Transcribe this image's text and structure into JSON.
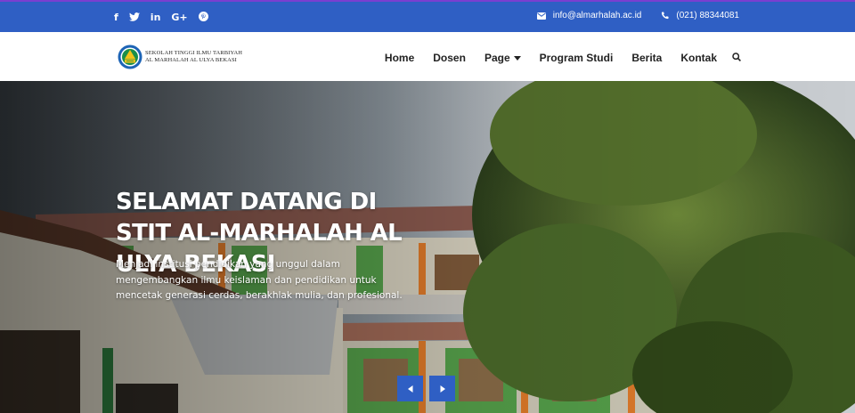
{
  "topbar": {
    "social": [
      {
        "icon": "facebook-icon",
        "glyph": "f"
      },
      {
        "icon": "twitter-icon",
        "glyph": "t"
      },
      {
        "icon": "linkedin-icon",
        "glyph": "in"
      },
      {
        "icon": "google-plus-icon",
        "glyph": "G+"
      },
      {
        "icon": "pinterest-icon",
        "glyph": "p"
      }
    ],
    "email": "info@almarhalah.ac.id",
    "phone": "(021) 88344081",
    "background": "#2f5fc4"
  },
  "logo": {
    "line1": "SEKOLAH TINGGI ILMU TARBIYAH",
    "line2": "AL MARHALAH AL ULYA BEKASI"
  },
  "nav": {
    "items": [
      {
        "label": "Home"
      },
      {
        "label": "Dosen"
      },
      {
        "label": "Page"
      },
      {
        "label": "Program Studi"
      },
      {
        "label": "Berita"
      },
      {
        "label": "Kontak"
      }
    ]
  },
  "hero": {
    "title": "SELAMAT DATANG DI STIT AL-MARHALAH AL ULYA BEKASI",
    "description": "Menjadi institusi pendidikan yang unggul dalam mengembangkan ilmu keislaman dan pendidikan untuk mencetak generasi cerdas, berakhlak mulia, dan profesional.",
    "accent": "#2f5fc4"
  }
}
